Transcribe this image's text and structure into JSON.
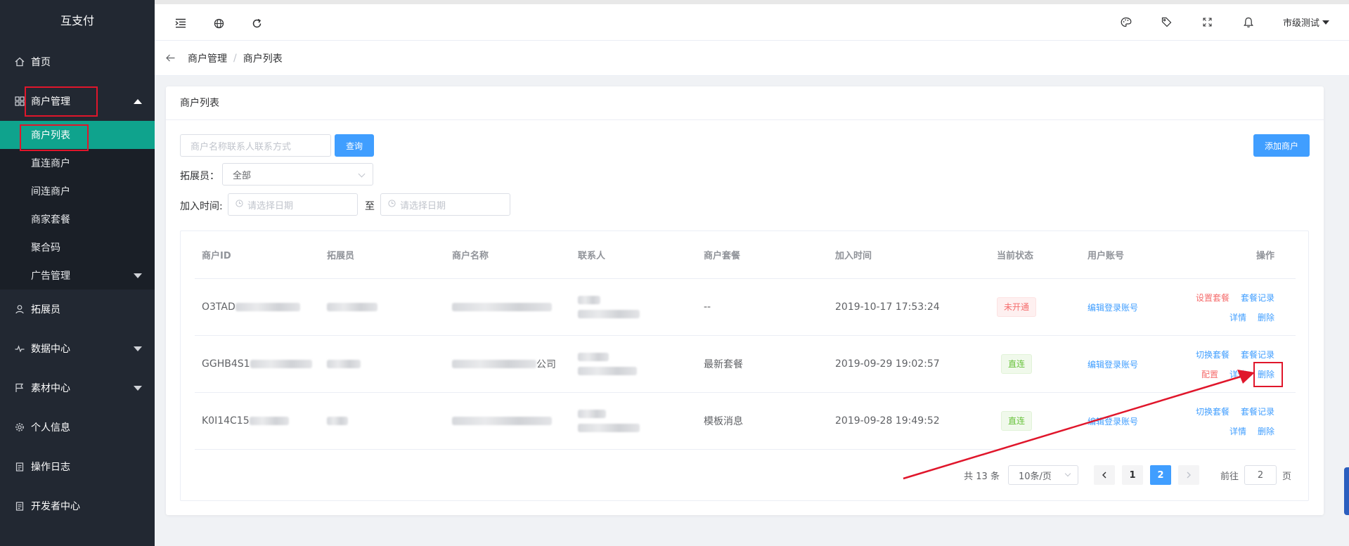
{
  "colors": {
    "sidebar_bg": "#222832",
    "active_menu": "#0fa38d",
    "primary": "#409eff",
    "danger": "#f56c6c",
    "success": "#67c23a",
    "annotation": "#e0162b"
  },
  "sidebar": {
    "brand": "互支付",
    "items": [
      {
        "label": "首页",
        "icon": "home-icon"
      },
      {
        "label": "商户管理",
        "icon": "grid-icon",
        "expanded": true
      },
      {
        "label": "拓展员",
        "icon": "user-icon"
      },
      {
        "label": "数据中心",
        "icon": "pulse-icon"
      },
      {
        "label": "素材中心",
        "icon": "flag-icon"
      },
      {
        "label": "个人信息",
        "icon": "gear-icon"
      },
      {
        "label": "操作日志",
        "icon": "clipboard-icon"
      },
      {
        "label": "开发者中心",
        "icon": "clipboard-icon"
      }
    ],
    "submenu": [
      {
        "label": "商户列表",
        "active": true
      },
      {
        "label": "直连商户"
      },
      {
        "label": "间连商户"
      },
      {
        "label": "商家套餐"
      },
      {
        "label": "聚合码"
      },
      {
        "label": "广告管理"
      }
    ]
  },
  "header": {
    "left_icons": [
      "menu-fold-icon",
      "globe-icon",
      "refresh-icon"
    ],
    "right_icons": [
      "palette-icon",
      "tag-icon",
      "fullscreen-icon",
      "bell-icon"
    ],
    "user": "市级测试"
  },
  "breadcrumb": {
    "items": [
      "商户管理",
      "商户列表"
    ],
    "separator": "/"
  },
  "card": {
    "title": "商户列表",
    "search_placeholder": "商户名称联系人联系方式",
    "search_button": "查询",
    "add_button": "添加商户",
    "promoter_label": "拓展员：",
    "promoter_value": "全部",
    "date_label": "加入时间:",
    "date_placeholder": "请选择日期",
    "date_to": "至"
  },
  "table": {
    "headers": [
      "商户ID",
      "拓展员",
      "商户名称",
      "联系人",
      "商户套餐",
      "加入时间",
      "当前状态",
      "用户账号",
      "操作"
    ],
    "rows": [
      {
        "id": "O3TAD",
        "package": "--",
        "joined": "2019-10-17 17:53:24",
        "status": "未开通",
        "status_type": "red",
        "account": "编辑登录账号",
        "ops_line1": [
          "设置套餐",
          "套餐记录"
        ],
        "ops_line2": [
          "详情",
          "删除"
        ],
        "ops_line1_first_red": true,
        "ops_line2_first_red": false
      },
      {
        "id": "GGHB4S1",
        "name_suffix": "公司",
        "package": "最新套餐",
        "joined": "2019-09-29 19:02:57",
        "status": "直连",
        "status_type": "green",
        "account": "编辑登录账号",
        "ops_line1": [
          "切换套餐",
          "套餐记录"
        ],
        "ops_line2": [
          "配置",
          "详情",
          "删除"
        ],
        "ops_line1_first_red": false,
        "ops_line2_first_red": true
      },
      {
        "id": "K0I14C15",
        "package": "模板消息",
        "joined": "2019-09-28 19:49:52",
        "status": "直连",
        "status_type": "green",
        "account": "编辑登录账号",
        "ops_line1": [
          "切换套餐",
          "套餐记录"
        ],
        "ops_line2": [
          "详情",
          "删除"
        ],
        "ops_line1_first_red": false,
        "ops_line2_first_red": false
      }
    ]
  },
  "pagination": {
    "total": "共 13 条",
    "page_size": "10条/页",
    "pages": [
      "1",
      "2"
    ],
    "current": "2",
    "goto_label": "前往",
    "goto_value": "2",
    "goto_suffix": "页"
  }
}
